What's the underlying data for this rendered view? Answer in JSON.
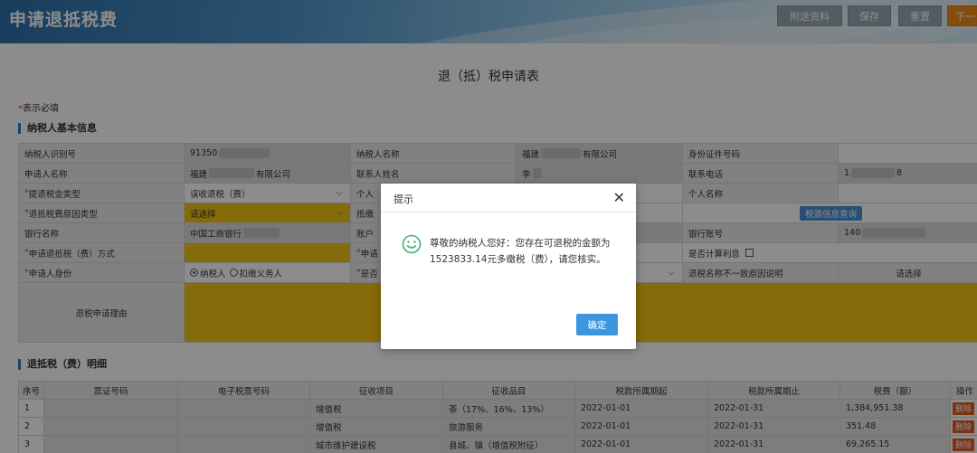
{
  "app": {
    "title": "申请退抵税费"
  },
  "toolbar": {
    "attach": "附送资料",
    "save": "保存",
    "reset": "重置",
    "next": "下一"
  },
  "form": {
    "title": "退（抵）税申请表",
    "required_note": "表示必填"
  },
  "sections": {
    "basic": "纳税人基本信息",
    "detail": "退抵税（费）明细"
  },
  "basic": {
    "r1": {
      "l1": "纳税人识别号",
      "v1": "91350",
      "l2": "纳税人名称",
      "v2a": "福建",
      "v2b": "有限公司",
      "l3": "身份证件号码",
      "v3": ""
    },
    "r2": {
      "l1": "申请人名称",
      "v1a": "福建",
      "v1b": "有限公司",
      "l2": "联系人姓名",
      "v2": "李",
      "l3": "联系电话",
      "v3a": "1",
      "v3b": "8"
    },
    "r3": {
      "l1": "提退税金类型",
      "v1": "误收退税（费）",
      "l2": "个人",
      "l3": "个人名称",
      "v3": ""
    },
    "r4": {
      "l1": "退抵税费原因类型",
      "v1": "请选择",
      "l2": "抵缴",
      "btn": "税源信息查询"
    },
    "r5": {
      "l1": "银行名称",
      "v1": "中国工商银行",
      "l2": "账户",
      "l3": "银行账号",
      "v3": "140"
    },
    "r6": {
      "l1": "申请退抵税（费）方式",
      "v1": "",
      "l2": "申请",
      "l3": "是否计算利息"
    },
    "r7": {
      "l1": "申请人身份",
      "opt1": "纳税人",
      "opt2": "扣缴义务人",
      "l2": "是否",
      "l3": "退税名称不一致原因说明",
      "v3": "请选择"
    },
    "r8": {
      "l1": "退税申请理由"
    }
  },
  "detail": {
    "headers": [
      "序号",
      "票证号码",
      "电子税票号码",
      "征收项目",
      "征收品目",
      "税款所属期起",
      "税款所属期止",
      "税费（额）",
      "操作"
    ],
    "rows": [
      {
        "no": "1",
        "ticket": "",
        "eticket": "",
        "item": "增值税",
        "sub": "茶（17%、16%、13%）",
        "start": "2022-01-01",
        "end": "2022-01-31",
        "amount": "1,384,951.38",
        "op": "删除"
      },
      {
        "no": "2",
        "ticket": "",
        "eticket": "",
        "item": "增值税",
        "sub": "旅游服务",
        "start": "2022-01-01",
        "end": "2022-01-31",
        "amount": "351.48",
        "op": "删除"
      },
      {
        "no": "3",
        "ticket": "",
        "eticket": "",
        "item": "城市维护建设税",
        "sub": "县城、镇（增值税附征）",
        "start": "2022-01-01",
        "end": "2022-01-31",
        "amount": "69,265.15",
        "op": "删除"
      }
    ]
  },
  "dialog": {
    "title": "提示",
    "message": "尊敬的纳税人您好：您存在可退税的金额为1523833.14元多缴税（费），请您核实。",
    "ok": "确定",
    "icon": "smile-icon",
    "icon_color": "#3cb371"
  }
}
